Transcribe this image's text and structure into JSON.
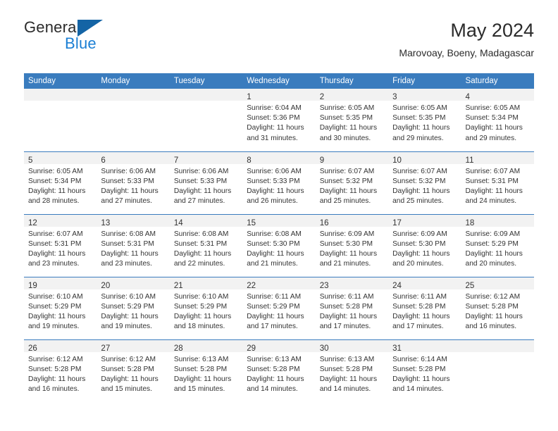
{
  "brand": {
    "line1": "General",
    "line2": "Blue",
    "flag_color": "#1464a5",
    "blue_text_color": "#1b7fd4"
  },
  "header": {
    "title": "May 2024",
    "location": "Marovoay, Boeny, Madagascar"
  },
  "theme": {
    "header_bg": "#3a7cbe",
    "header_text": "#ffffff",
    "daynum_band_bg": "#f2f2f2",
    "body_text": "#333333",
    "row_divider": "#3a7cbe"
  },
  "weekday_headers": [
    "Sunday",
    "Monday",
    "Tuesday",
    "Wednesday",
    "Thursday",
    "Friday",
    "Saturday"
  ],
  "weeks": [
    [
      {
        "day": "",
        "empty": true,
        "sunrise": "",
        "sunset": "",
        "daylight1": "",
        "daylight2": ""
      },
      {
        "day": "",
        "empty": true,
        "sunrise": "",
        "sunset": "",
        "daylight1": "",
        "daylight2": ""
      },
      {
        "day": "",
        "empty": true,
        "sunrise": "",
        "sunset": "",
        "daylight1": "",
        "daylight2": ""
      },
      {
        "day": "1",
        "empty": false,
        "sunrise": "Sunrise: 6:04 AM",
        "sunset": "Sunset: 5:36 PM",
        "daylight1": "Daylight: 11 hours",
        "daylight2": "and 31 minutes."
      },
      {
        "day": "2",
        "empty": false,
        "sunrise": "Sunrise: 6:05 AM",
        "sunset": "Sunset: 5:35 PM",
        "daylight1": "Daylight: 11 hours",
        "daylight2": "and 30 minutes."
      },
      {
        "day": "3",
        "empty": false,
        "sunrise": "Sunrise: 6:05 AM",
        "sunset": "Sunset: 5:35 PM",
        "daylight1": "Daylight: 11 hours",
        "daylight2": "and 29 minutes."
      },
      {
        "day": "4",
        "empty": false,
        "sunrise": "Sunrise: 6:05 AM",
        "sunset": "Sunset: 5:34 PM",
        "daylight1": "Daylight: 11 hours",
        "daylight2": "and 29 minutes."
      }
    ],
    [
      {
        "day": "5",
        "empty": false,
        "sunrise": "Sunrise: 6:05 AM",
        "sunset": "Sunset: 5:34 PM",
        "daylight1": "Daylight: 11 hours",
        "daylight2": "and 28 minutes."
      },
      {
        "day": "6",
        "empty": false,
        "sunrise": "Sunrise: 6:06 AM",
        "sunset": "Sunset: 5:33 PM",
        "daylight1": "Daylight: 11 hours",
        "daylight2": "and 27 minutes."
      },
      {
        "day": "7",
        "empty": false,
        "sunrise": "Sunrise: 6:06 AM",
        "sunset": "Sunset: 5:33 PM",
        "daylight1": "Daylight: 11 hours",
        "daylight2": "and 27 minutes."
      },
      {
        "day": "8",
        "empty": false,
        "sunrise": "Sunrise: 6:06 AM",
        "sunset": "Sunset: 5:33 PM",
        "daylight1": "Daylight: 11 hours",
        "daylight2": "and 26 minutes."
      },
      {
        "day": "9",
        "empty": false,
        "sunrise": "Sunrise: 6:07 AM",
        "sunset": "Sunset: 5:32 PM",
        "daylight1": "Daylight: 11 hours",
        "daylight2": "and 25 minutes."
      },
      {
        "day": "10",
        "empty": false,
        "sunrise": "Sunrise: 6:07 AM",
        "sunset": "Sunset: 5:32 PM",
        "daylight1": "Daylight: 11 hours",
        "daylight2": "and 25 minutes."
      },
      {
        "day": "11",
        "empty": false,
        "sunrise": "Sunrise: 6:07 AM",
        "sunset": "Sunset: 5:31 PM",
        "daylight1": "Daylight: 11 hours",
        "daylight2": "and 24 minutes."
      }
    ],
    [
      {
        "day": "12",
        "empty": false,
        "sunrise": "Sunrise: 6:07 AM",
        "sunset": "Sunset: 5:31 PM",
        "daylight1": "Daylight: 11 hours",
        "daylight2": "and 23 minutes."
      },
      {
        "day": "13",
        "empty": false,
        "sunrise": "Sunrise: 6:08 AM",
        "sunset": "Sunset: 5:31 PM",
        "daylight1": "Daylight: 11 hours",
        "daylight2": "and 23 minutes."
      },
      {
        "day": "14",
        "empty": false,
        "sunrise": "Sunrise: 6:08 AM",
        "sunset": "Sunset: 5:31 PM",
        "daylight1": "Daylight: 11 hours",
        "daylight2": "and 22 minutes."
      },
      {
        "day": "15",
        "empty": false,
        "sunrise": "Sunrise: 6:08 AM",
        "sunset": "Sunset: 5:30 PM",
        "daylight1": "Daylight: 11 hours",
        "daylight2": "and 21 minutes."
      },
      {
        "day": "16",
        "empty": false,
        "sunrise": "Sunrise: 6:09 AM",
        "sunset": "Sunset: 5:30 PM",
        "daylight1": "Daylight: 11 hours",
        "daylight2": "and 21 minutes."
      },
      {
        "day": "17",
        "empty": false,
        "sunrise": "Sunrise: 6:09 AM",
        "sunset": "Sunset: 5:30 PM",
        "daylight1": "Daylight: 11 hours",
        "daylight2": "and 20 minutes."
      },
      {
        "day": "18",
        "empty": false,
        "sunrise": "Sunrise: 6:09 AM",
        "sunset": "Sunset: 5:29 PM",
        "daylight1": "Daylight: 11 hours",
        "daylight2": "and 20 minutes."
      }
    ],
    [
      {
        "day": "19",
        "empty": false,
        "sunrise": "Sunrise: 6:10 AM",
        "sunset": "Sunset: 5:29 PM",
        "daylight1": "Daylight: 11 hours",
        "daylight2": "and 19 minutes."
      },
      {
        "day": "20",
        "empty": false,
        "sunrise": "Sunrise: 6:10 AM",
        "sunset": "Sunset: 5:29 PM",
        "daylight1": "Daylight: 11 hours",
        "daylight2": "and 19 minutes."
      },
      {
        "day": "21",
        "empty": false,
        "sunrise": "Sunrise: 6:10 AM",
        "sunset": "Sunset: 5:29 PM",
        "daylight1": "Daylight: 11 hours",
        "daylight2": "and 18 minutes."
      },
      {
        "day": "22",
        "empty": false,
        "sunrise": "Sunrise: 6:11 AM",
        "sunset": "Sunset: 5:29 PM",
        "daylight1": "Daylight: 11 hours",
        "daylight2": "and 17 minutes."
      },
      {
        "day": "23",
        "empty": false,
        "sunrise": "Sunrise: 6:11 AM",
        "sunset": "Sunset: 5:28 PM",
        "daylight1": "Daylight: 11 hours",
        "daylight2": "and 17 minutes."
      },
      {
        "day": "24",
        "empty": false,
        "sunrise": "Sunrise: 6:11 AM",
        "sunset": "Sunset: 5:28 PM",
        "daylight1": "Daylight: 11 hours",
        "daylight2": "and 17 minutes."
      },
      {
        "day": "25",
        "empty": false,
        "sunrise": "Sunrise: 6:12 AM",
        "sunset": "Sunset: 5:28 PM",
        "daylight1": "Daylight: 11 hours",
        "daylight2": "and 16 minutes."
      }
    ],
    [
      {
        "day": "26",
        "empty": false,
        "sunrise": "Sunrise: 6:12 AM",
        "sunset": "Sunset: 5:28 PM",
        "daylight1": "Daylight: 11 hours",
        "daylight2": "and 16 minutes."
      },
      {
        "day": "27",
        "empty": false,
        "sunrise": "Sunrise: 6:12 AM",
        "sunset": "Sunset: 5:28 PM",
        "daylight1": "Daylight: 11 hours",
        "daylight2": "and 15 minutes."
      },
      {
        "day": "28",
        "empty": false,
        "sunrise": "Sunrise: 6:13 AM",
        "sunset": "Sunset: 5:28 PM",
        "daylight1": "Daylight: 11 hours",
        "daylight2": "and 15 minutes."
      },
      {
        "day": "29",
        "empty": false,
        "sunrise": "Sunrise: 6:13 AM",
        "sunset": "Sunset: 5:28 PM",
        "daylight1": "Daylight: 11 hours",
        "daylight2": "and 14 minutes."
      },
      {
        "day": "30",
        "empty": false,
        "sunrise": "Sunrise: 6:13 AM",
        "sunset": "Sunset: 5:28 PM",
        "daylight1": "Daylight: 11 hours",
        "daylight2": "and 14 minutes."
      },
      {
        "day": "31",
        "empty": false,
        "sunrise": "Sunrise: 6:14 AM",
        "sunset": "Sunset: 5:28 PM",
        "daylight1": "Daylight: 11 hours",
        "daylight2": "and 14 minutes."
      },
      {
        "day": "",
        "empty": true,
        "sunrise": "",
        "sunset": "",
        "daylight1": "",
        "daylight2": ""
      }
    ]
  ]
}
